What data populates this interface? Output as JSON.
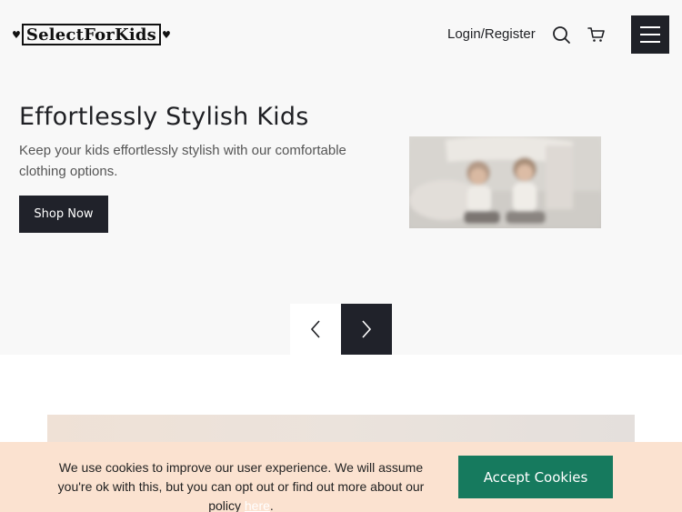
{
  "header": {
    "logo_text": "SelectForKids",
    "login_label": "Login/Register",
    "icons": [
      "search-icon",
      "cart-icon",
      "hamburger-menu-icon"
    ],
    "menu_bg": "#1f2128"
  },
  "hero": {
    "title": "Effortlessly Stylish Kids",
    "subtitle": "Keep your kids effortlessly stylish with our comfortable clothing options.",
    "button_label": "Shop Now",
    "carousel_icons": [
      "chevron-left-icon",
      "chevron-right-icon"
    ],
    "background": "#f8f8f8"
  },
  "cookie": {
    "text": "We use cookies to improve our user experience. We will assume you're ok with this, but you can opt out or find out more about our policy",
    "link_label": "here",
    "suffix": ".",
    "accept_label": "Accept Cookies",
    "background": "#fbe2d0",
    "accept_color": "#167a5e"
  }
}
